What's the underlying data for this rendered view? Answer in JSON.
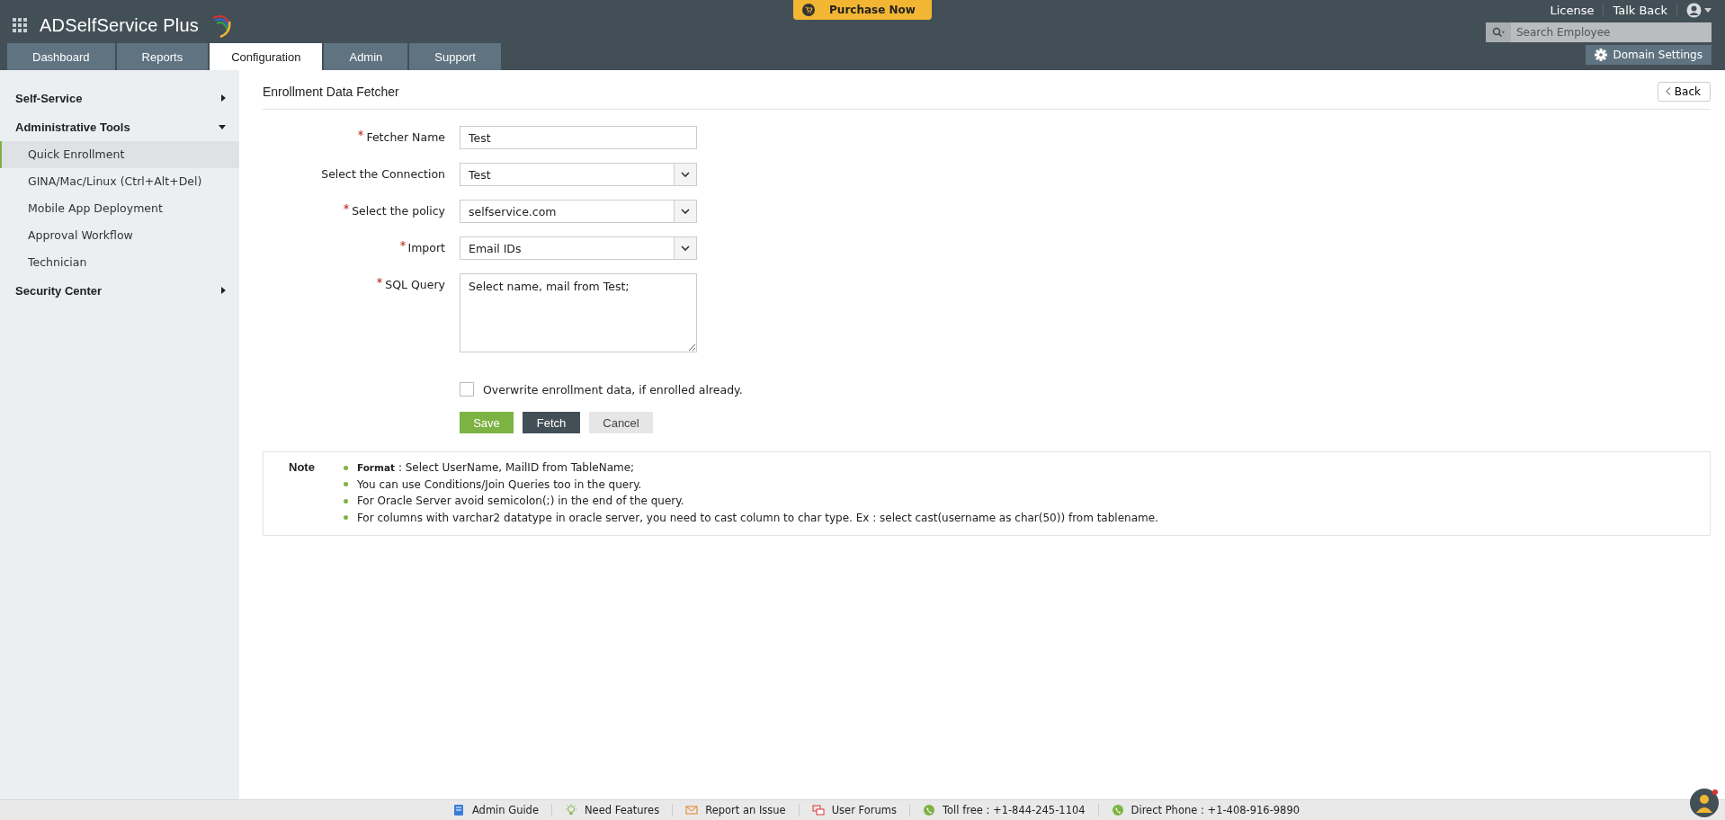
{
  "header": {
    "product_name": "ADSelfService Plus",
    "purchase_button": "Purchase Now",
    "links": [
      "License",
      "Talk Back"
    ],
    "search": {
      "placeholder": "Search Employee"
    },
    "domain_settings": "Domain Settings"
  },
  "tabs": [
    {
      "label": "Dashboard",
      "selected": false
    },
    {
      "label": "Reports",
      "selected": false
    },
    {
      "label": "Configuration",
      "selected": true
    },
    {
      "label": "Admin",
      "selected": false
    },
    {
      "label": "Support",
      "selected": false
    }
  ],
  "sidebar": [
    {
      "label": "Self-Service",
      "expanded": false
    },
    {
      "label": "Administrative Tools",
      "expanded": true,
      "children": [
        {
          "label": "Quick Enrollment",
          "selected": true
        },
        {
          "label": "GINA/Mac/Linux (Ctrl+Alt+Del)",
          "selected": false
        },
        {
          "label": "Mobile App Deployment",
          "selected": false
        },
        {
          "label": "Approval Workflow",
          "selected": false
        },
        {
          "label": "Technician",
          "selected": false
        }
      ]
    },
    {
      "label": "Security Center",
      "expanded": false
    }
  ],
  "page": {
    "title": "Enrollment Data Fetcher",
    "back_button": "Back"
  },
  "form": {
    "fields": [
      {
        "kind": "text",
        "label": "Fetcher Name",
        "required": true,
        "value": "Test"
      },
      {
        "kind": "select",
        "label": "Select the Connection",
        "required": false,
        "value": "Test"
      },
      {
        "kind": "select",
        "label": "Select the policy",
        "required": true,
        "value": "selfservice.com"
      },
      {
        "kind": "select",
        "label": "Import",
        "required": true,
        "value": "Email IDs"
      },
      {
        "kind": "textarea",
        "label": "SQL Query",
        "required": true,
        "value": "Select name, mail from Test;"
      }
    ],
    "checkbox": {
      "label": "Overwrite enrollment data, if enrolled already.",
      "checked": false
    },
    "buttons": [
      {
        "label": "Save",
        "kind": "primary"
      },
      {
        "label": "Fetch",
        "kind": "dark"
      },
      {
        "label": "Cancel",
        "kind": "plain"
      }
    ]
  },
  "note": {
    "title": "Note",
    "items": [
      "**Format** : Select UserName, MailID from TableName;",
      "You can use Conditions/Join Queries too in the query.",
      "For Oracle Server avoid semicolon(;) in the end of the query.",
      "For columns with varchar2 datatype in oracle server, you need to cast column to char type. Ex : select cast(username as char(50)) from tablename."
    ]
  },
  "footer": [
    {
      "kind": "guide",
      "label": "Admin Guide"
    },
    {
      "kind": "features",
      "label": "Need Features"
    },
    {
      "kind": "issue",
      "label": "Report an Issue"
    },
    {
      "kind": "forums",
      "label": "User Forums"
    },
    {
      "kind": "phone",
      "label": "Toll free : +1-844-245-1104"
    },
    {
      "kind": "phone",
      "label": "Direct Phone : +1-408-916-9890"
    }
  ]
}
